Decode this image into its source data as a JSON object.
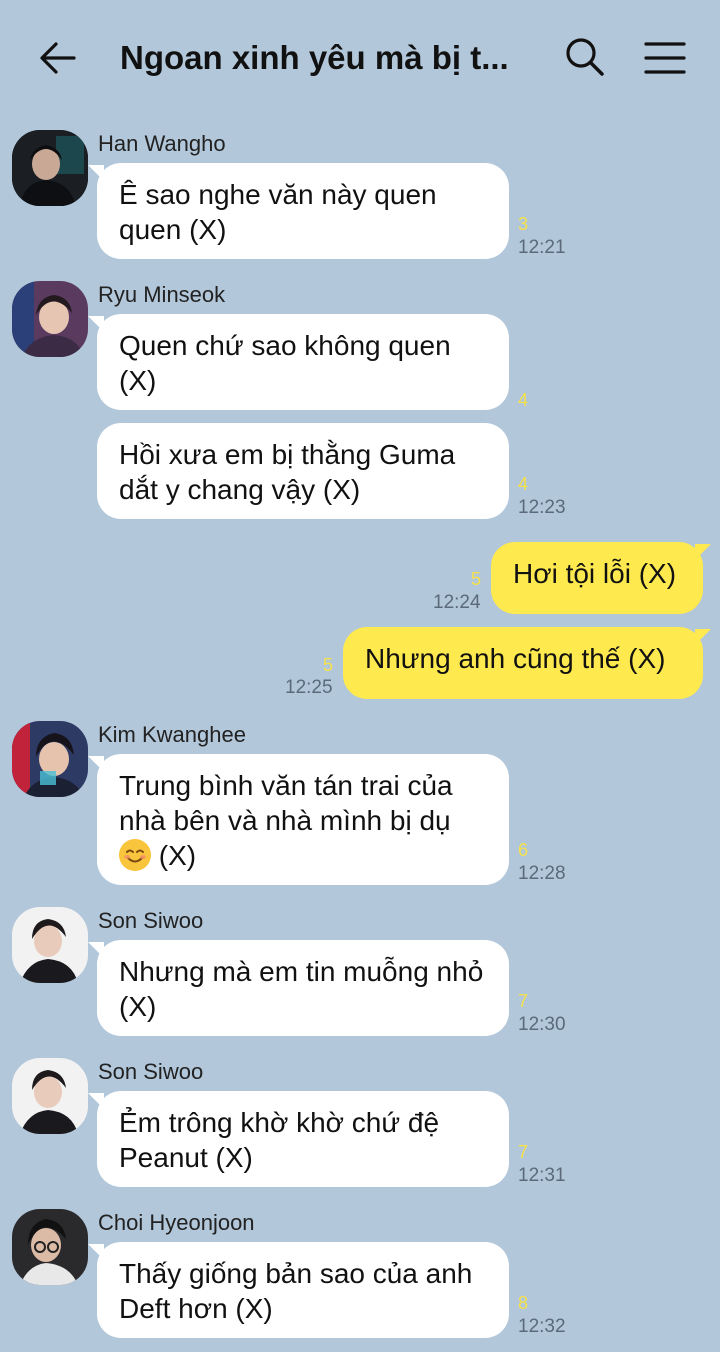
{
  "header": {
    "title": "Ngoan xinh yêu mà bị t...",
    "back_icon": "arrow-left-icon",
    "search_icon": "search-icon",
    "menu_icon": "hamburger-menu-icon"
  },
  "messages": [
    {
      "sender": "Han Wangho",
      "text": "Ê sao nghe văn này quen quen (X)",
      "unread": "3",
      "time": "12:21"
    },
    {
      "sender": "Ryu Minseok",
      "text": "Quen chứ sao không quen (X)",
      "unread": "4"
    },
    {
      "text": "Hồi xưa em bị thằng Guma dắt y chang vậy (X)",
      "unread": "4",
      "time": "12:23"
    },
    {
      "text": "Hơi tội lỗi (X)",
      "unread": "5",
      "time": "12:24"
    },
    {
      "text": "Nhưng anh cũng thế (X)",
      "unread": "5",
      "time": "12:25"
    },
    {
      "sender": "Kim Kwanghee",
      "text_before": "Trung bình văn tán trai của nhà bên và nhà mình bị dụ",
      "emoji": "☺️",
      "text_after": " (X)",
      "unread": "6",
      "time": "12:28"
    },
    {
      "sender": "Son Siwoo",
      "text": "Nhưng mà em tin muỗng nhỏ (X)",
      "unread": "7",
      "time": "12:30"
    },
    {
      "sender": "Son Siwoo",
      "text": "Ẻm trông khờ khờ chứ đệ Peanut (X)",
      "unread": "7",
      "time": "12:31"
    },
    {
      "sender": "Choi Hyeonjoon",
      "text": "Thấy giống bản sao của anh Deft hơn (X)",
      "unread": "8",
      "time": "12:32"
    }
  ],
  "colors": {
    "background": "#b2c7da",
    "incoming_bubble": "#ffffff",
    "outgoing_bubble": "#fee94e",
    "unread_count": "#f5e14a",
    "timestamp": "#5b6a7a"
  }
}
